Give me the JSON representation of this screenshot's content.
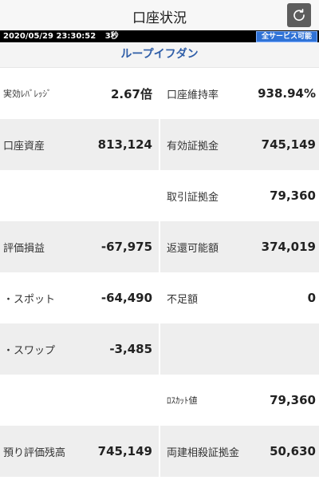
{
  "header": {
    "title": "口座状況"
  },
  "status": {
    "datetime": "2020/05/29 23:30:52",
    "interval": "3秒",
    "badge": "全サービス可能"
  },
  "section": {
    "title": "ループイフダン"
  },
  "rows": [
    {
      "left": {
        "label": "実効ﾚﾊﾞﾚｯｼﾞ",
        "value": "2.67倍"
      },
      "right": {
        "label": "口座維持率",
        "value": "938.94%"
      }
    },
    {
      "left": {
        "label": "口座資産",
        "value": "813,124"
      },
      "right": {
        "label": "有効証拠金",
        "value": "745,149"
      }
    },
    {
      "left": {
        "label": "",
        "value": ""
      },
      "right": {
        "label": "取引証拠金",
        "value": "79,360"
      }
    },
    {
      "left": {
        "label": "評価損益",
        "value": "-67,975"
      },
      "right": {
        "label": "返還可能額",
        "value": "374,019"
      }
    },
    {
      "left": {
        "label": "・スポット",
        "value": "-64,490"
      },
      "right": {
        "label": "不足額",
        "value": "0"
      }
    },
    {
      "left": {
        "label": "・スワップ",
        "value": "-3,485"
      },
      "right": {
        "label": "",
        "value": ""
      }
    },
    {
      "left": {
        "label": "",
        "value": ""
      },
      "right": {
        "label": "ﾛｽｶｯﾄ値",
        "value": "79,360"
      }
    },
    {
      "left": {
        "label": "預り評価残高",
        "value": "745,149"
      },
      "right": {
        "label": "両建相殺証拠金",
        "value": "50,630"
      }
    }
  ],
  "icons": {
    "refresh": "refresh-icon"
  },
  "colors": {
    "accent": "#2f5ea8",
    "badge": "#2f72d6",
    "row_alt": "#eeeeee"
  }
}
